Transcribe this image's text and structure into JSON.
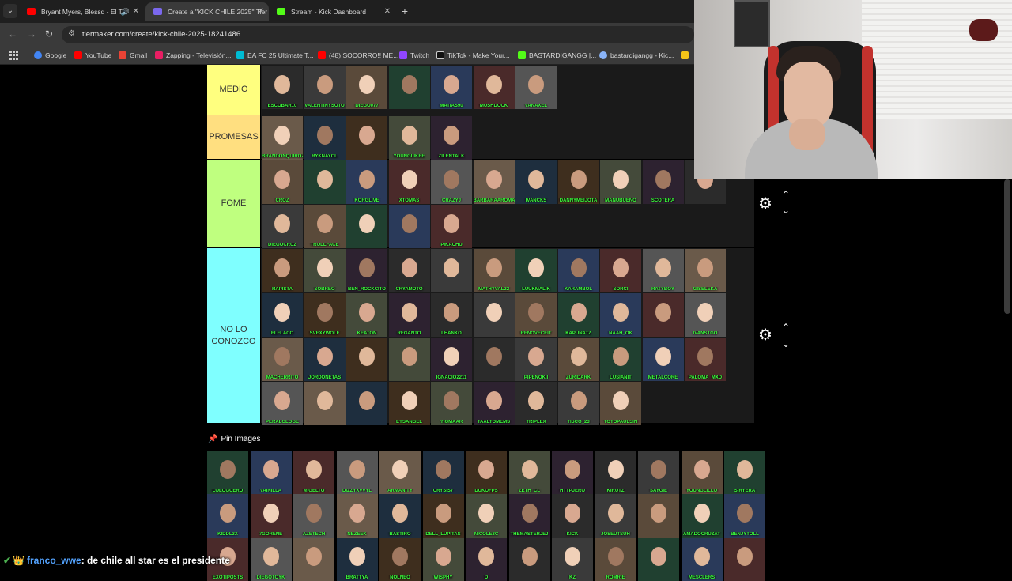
{
  "browser": {
    "tabs": [
      {
        "title": "Bryant Myers, Blessd - El Ti",
        "favicon_color": "#ff0000",
        "active": false,
        "audio": true
      },
      {
        "title": "Create a \"KICK CHILE 2025\" Tier",
        "favicon_color": "#7b68ee",
        "active": true,
        "audio": false
      },
      {
        "title": "Stream - Kick Dashboard",
        "favicon_color": "#53fc18",
        "active": false,
        "audio": false
      }
    ],
    "url": "tiermaker.com/create/kick-chile-2025-18241486",
    "bookmarks": [
      {
        "label": "Google",
        "color": "#4285f4"
      },
      {
        "label": "YouTube",
        "color": "#ff0000"
      },
      {
        "label": "Gmail",
        "color": "#ea4335"
      },
      {
        "label": "Zapping - Televisión...",
        "color": "#e91e63"
      },
      {
        "label": "EA FC 25 Ultimate T...",
        "color": "#00bcd4"
      },
      {
        "label": "(48) SOCORRO!! ME...",
        "color": "#ff0000"
      },
      {
        "label": "Twitch",
        "color": "#9146ff"
      },
      {
        "label": "TikTok - Make Your...",
        "color": "#111111"
      },
      {
        "label": "BASTARDIGANGG |...",
        "color": "#53fc18"
      },
      {
        "label": "bastardigangg - Kic...",
        "color": "#8ab4f8"
      }
    ]
  },
  "tiers": [
    {
      "label": "MEDIO",
      "color": "#ffff7f",
      "items": [
        "ESCOBAR10",
        "VALENTINYSOTO",
        "DIEGO077",
        "",
        "MATIAS90",
        "MUSHDOCK",
        "VANAXEL"
      ]
    },
    {
      "label": "PROMESAS",
      "color": "#ffdf80",
      "items": [
        "BRANDONQUIROZ",
        "RYKNAYCL",
        "",
        "YOUNGLIKEE",
        "ZILENTALK"
      ]
    },
    {
      "label": "FOME",
      "color": "#bfff7f",
      "items": [
        "CROZ",
        "",
        "KORGLIVE",
        "XTOMAS",
        "CRAZYJ",
        "BARBARAAROMANE",
        "IVANCKS",
        "DANNYMEIJOTA",
        "MANUBUENO",
        "SCOTERA",
        "",
        "DIEGOCRUZ",
        "TROLLFACE",
        "",
        "",
        "PIKACHU"
      ]
    },
    {
      "label": "NO LO CONOZCO",
      "color": "#7fffff",
      "items": [
        "RAPISTA",
        "SOBREO",
        "BEN_ROCKCITO",
        "CRYAMOTO",
        "",
        "MATHYVAL22",
        "LUUKMALIK",
        "KARAMBOL",
        "SORCI",
        "RATYBOY",
        "GISELEKA",
        "ELFLACO",
        "SVEXYWOLF",
        "KEATON",
        "REGANTO",
        "LHANKO",
        "",
        "RENOVECEIT",
        "KAPUNATZ",
        "NAAH_OK",
        "",
        "IVANSTGO",
        "MACHERRITO",
        "JORDONETAS",
        "",
        "",
        "IGNACIO2211",
        "",
        "PIPENOKII",
        "ZURIDARK",
        "LUSIANIT",
        "METALCORE",
        "PALOMA_MXD",
        "PERALGLOGE",
        "",
        "",
        "EYSANGEL",
        "YIOMAAR",
        "TAALTOMEMS",
        "TRIPLEX",
        "TISCO_23",
        "TOTOPAULSIN"
      ]
    }
  ],
  "tier_controls": {
    "gear": "gear-icon",
    "up": "chevron-up-icon",
    "down": "chevron-down-icon"
  },
  "pool": {
    "header": "Pin Images",
    "items": [
      "LOLOGUERO",
      "VAINILLA",
      "MIGELTO",
      "DIZZYXVVYL",
      "ARMANITY",
      "CRYSIS7",
      "DUKOFPS",
      "ZETH_CL",
      "HTTPJERO",
      "KIRUTZ",
      "SAYGIE",
      "YOUNGLILLO",
      "SIRYERA",
      "KIDDL3X",
      "7GORENE",
      "AZETECH",
      "NEZEEK",
      "BASTIRO",
      "DELL_LUPITAS",
      "NICOLE3C",
      "THEMASTERJEJ",
      "KICK",
      "JOSEUTSUH",
      "",
      "AMADOCRUZAT",
      "BENJYTOLL",
      "EXOTIPOSTS",
      "DIEGOTOYK",
      "",
      "BRATTYA",
      "NOLNEO",
      "WISPHY",
      "D",
      "",
      "KZ",
      "ROMRIE",
      "",
      "MESCLERS",
      ""
    ]
  },
  "chat": {
    "username": "franco_wwe",
    "message": ": de chile all star es el presidente"
  }
}
